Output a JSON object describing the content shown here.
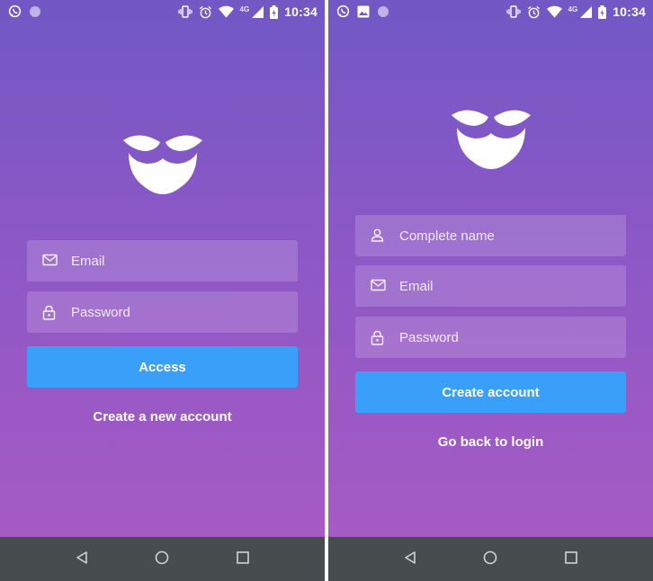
{
  "colors": {
    "gradient_top": "#7158c5",
    "gradient_bottom": "#a65ac4",
    "accent_button": "#3a9ff8",
    "navbar": "#474d4f",
    "text": "#ffffff"
  },
  "status_bar": {
    "time": "10:34",
    "network": "4G"
  },
  "login_screen": {
    "logo_icon": "mustache-beard-icon",
    "email_placeholder": "Email",
    "password_placeholder": "Password",
    "submit_label": "Access",
    "create_account_link": "Create a new account"
  },
  "signup_screen": {
    "logo_icon": "mustache-beard-icon",
    "name_placeholder": "Complete name",
    "email_placeholder": "Email",
    "password_placeholder": "Password",
    "submit_label": "Create account",
    "back_link": "Go back to login"
  },
  "nav_bar": {
    "icons": [
      "back-icon",
      "home-icon",
      "recents-icon"
    ]
  }
}
